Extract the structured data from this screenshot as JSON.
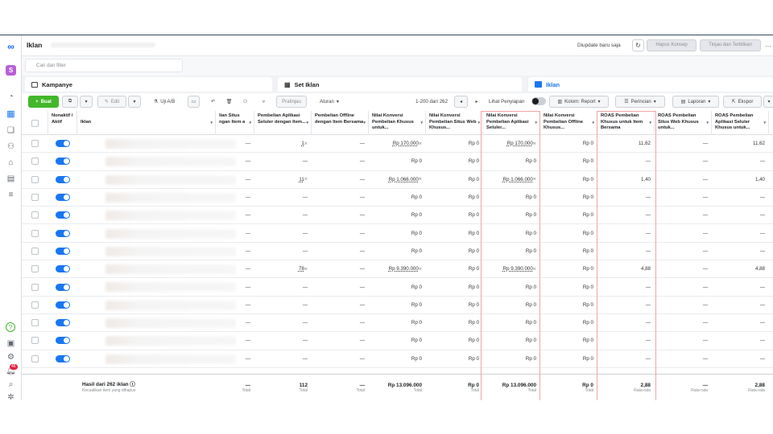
{
  "app": {
    "title": "Iklan",
    "updated": "Diupdate baru saja",
    "delete_label": "Hapus Konsep",
    "review_label": "Tinjau dan Terbitkan",
    "more_icon": "more-horizontal-icon"
  },
  "filter": {
    "placeholder": "Cari dan filter"
  },
  "levels": {
    "campaign": "Kampanye",
    "adset": "Set Iklan",
    "ad": "Iklan"
  },
  "rail": {
    "notif_count": "46"
  },
  "toolbar": {
    "create": "Buat",
    "edit": "Edit",
    "ab": "Uji A/B",
    "preview": "Pratinjau",
    "rules": "Aturan",
    "range": "1-200 dari 262",
    "view_setup": "Lihat Penyiapan",
    "columns": "Kolom: Report",
    "breakdown": "Perincian",
    "reports": "Laporan",
    "export": "Ekspor"
  },
  "columns": {
    "status": "Nonaktif / Aktif",
    "ad": "Iklan",
    "c1": "lian Situs ngan Item a",
    "c2": "Pembelian Aplikasi Seluler dengan Item...",
    "c3": "Pembelian Offline dengan Item Bersama",
    "c4": "Nilai Konversi Pembelian Khusus untuk...",
    "c5": "Nilai Konversi Pembelian Situs Web Khusus...",
    "c6": "Nilai Konversi Pembelian Aplikasi Seluler...",
    "c7": "Nilai Konversi Pembelian Offline Khusus...",
    "c8": "ROAS Pembelian Khusus untuk Item Bersama",
    "c9": "ROAS Pembelian Situs Web Khusus untuk...",
    "c10": "ROAS Pembelian Aplikasi Seluler Khusus untuk..."
  },
  "rows": [
    [
      "—",
      "1",
      "—",
      "Rp 170.000",
      "Rp 0",
      "Rp 170.000",
      "Rp 0",
      "11,62",
      "—",
      "11,62"
    ],
    [
      "—",
      "—",
      "—",
      "Rp 0",
      "Rp 0",
      "Rp 0",
      "Rp 0",
      "—",
      "—",
      "—"
    ],
    [
      "—",
      "11",
      "—",
      "Rp 1.066.000",
      "Rp 0",
      "Rp 1.066.000",
      "Rp 0",
      "1,40",
      "—",
      "1,40"
    ],
    [
      "—",
      "—",
      "—",
      "Rp 0",
      "Rp 0",
      "Rp 0",
      "Rp 0",
      "—",
      "—",
      "—"
    ],
    [
      "—",
      "—",
      "—",
      "Rp 0",
      "Rp 0",
      "Rp 0",
      "Rp 0",
      "—",
      "—",
      "—"
    ],
    [
      "—",
      "—",
      "—",
      "Rp 0",
      "Rp 0",
      "Rp 0",
      "Rp 0",
      "—",
      "—",
      "—"
    ],
    [
      "—",
      "—",
      "—",
      "Rp 0",
      "Rp 0",
      "Rp 0",
      "Rp 0",
      "—",
      "—",
      "—"
    ],
    [
      "—",
      "78",
      "—",
      "Rp 9.390.000",
      "Rp 0",
      "Rp 9.390.000",
      "Rp 0",
      "4,88",
      "—",
      "4,88"
    ],
    [
      "—",
      "—",
      "—",
      "Rp 0",
      "Rp 0",
      "Rp 0",
      "Rp 0",
      "—",
      "—",
      "—"
    ],
    [
      "—",
      "—",
      "—",
      "Rp 0",
      "Rp 0",
      "Rp 0",
      "Rp 0",
      "—",
      "—",
      "—"
    ],
    [
      "—",
      "—",
      "—",
      "Rp 0",
      "Rp 0",
      "Rp 0",
      "Rp 0",
      "—",
      "—",
      "—"
    ],
    [
      "—",
      "—",
      "—",
      "Rp 0",
      "Rp 0",
      "Rp 0",
      "Rp 0",
      "—",
      "—",
      "—"
    ],
    [
      "—",
      "—",
      "—",
      "Rp 0",
      "Rp 0",
      "Rp 0",
      "Rp 0",
      "—",
      "—",
      "—"
    ]
  ],
  "totals": {
    "label": "Hasil dari 262 iklan",
    "sub": "Kecualikan item yang dihapus",
    "values": [
      "—",
      "112",
      "—",
      "Rp 13.096.000",
      "Rp 0",
      "Rp 13.096.000",
      "Rp 0",
      "2,88",
      "—",
      "2,88"
    ],
    "notes": [
      "Total",
      "Total",
      "Total",
      "Total",
      "Total",
      "Total",
      "Total",
      "Rata-rata",
      "Rata-rata",
      "Rata-rata"
    ]
  }
}
